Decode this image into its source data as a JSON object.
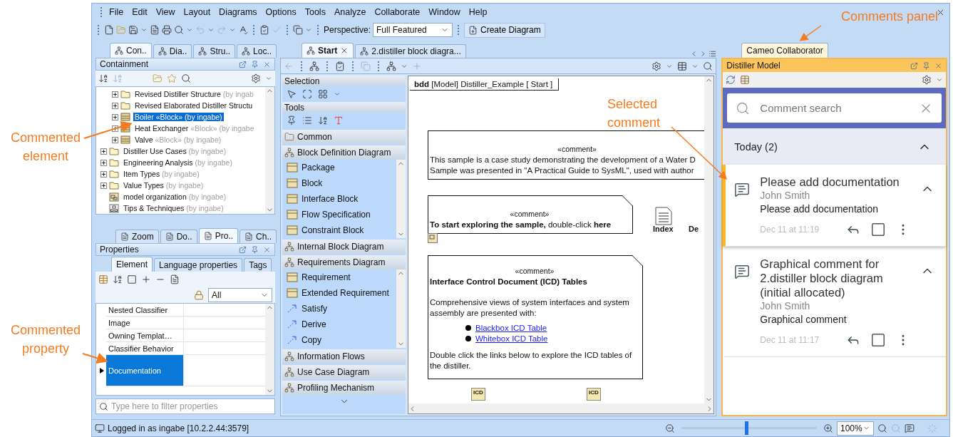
{
  "annotations": [
    {
      "text": "Commented element"
    },
    {
      "text": "Commented property"
    },
    {
      "text": "Selected comment"
    },
    {
      "text": "Comments panel"
    }
  ],
  "menu": [
    "File",
    "Edit",
    "View",
    "Layout",
    "Diagrams",
    "Options",
    "Tools",
    "Analyze",
    "Collaborate",
    "Window",
    "Help"
  ],
  "toolbar": {
    "perspective_label": "Perspective:",
    "perspective": "Full Featured",
    "create_diagram": "Create Diagram"
  },
  "browser_tabs": [
    {
      "label": "Con..",
      "selected": true
    },
    {
      "label": "Dia..",
      "selected": false
    },
    {
      "label": "Stru..",
      "selected": false
    },
    {
      "label": "Loc..",
      "selected": false
    }
  ],
  "containment": {
    "title": "Containment",
    "tree": [
      {
        "children": [
          {
            "label": "Revised Distiller Structure",
            "owner": "(by ingab",
            "kind": "folder",
            "expandable": true,
            "selected": false
          },
          {
            "label": "Revised Elaborated  Distiller Structu",
            "kind": "folder",
            "expandable": true,
            "selected": false
          },
          {
            "label": "Boiler",
            "stereotype": "«Block»",
            "owner": "(by ingabe)",
            "kind": "block",
            "expandable": true,
            "selected": true
          },
          {
            "label": "Heat Exchanger",
            "stereotype": "«Block»",
            "owner": "(by ingabe",
            "kind": "block",
            "expandable": true,
            "selected": false
          },
          {
            "label": "Valve",
            "stereotype": "«Block»",
            "owner": "(by ingabe)",
            "kind": "block",
            "expandable": true,
            "selected": false
          }
        ]
      },
      {
        "label": "Distiller Use Cases",
        "owner": "(by ingabe)",
        "kind": "folder",
        "expandable": true,
        "selected": false
      },
      {
        "label": "Engineering Analysis",
        "owner": "(by ingabe)",
        "kind": "folder",
        "expandable": true,
        "selected": false
      },
      {
        "label": "Item Types",
        "owner": "(by ingabe)",
        "kind": "folder",
        "expandable": true,
        "selected": false
      },
      {
        "label": "Value Types",
        "owner": "(by ingabe)",
        "kind": "folder",
        "expandable": true,
        "selected": false
      },
      {
        "label": "model organization",
        "owner": "(by ingabe)",
        "kind": "package-diagram",
        "expandable": false,
        "selected": false
      },
      {
        "label": "Tips & Techniques",
        "owner": "(by ingabe)",
        "kind": "diagram",
        "expandable": false,
        "selected": false
      }
    ]
  },
  "property_tabs": [
    {
      "label": "Zoom",
      "selected": false
    },
    {
      "label": "Do..",
      "selected": false
    },
    {
      "label": "Pro..",
      "selected": true
    },
    {
      "label": "Ch..",
      "selected": false
    }
  ],
  "properties": {
    "title": "Properties",
    "tabs": [
      {
        "label": "Element",
        "selected": true
      },
      {
        "label": "Language properties",
        "selected": false
      },
      {
        "label": "Tags",
        "selected": false
      }
    ],
    "filter": "All",
    "rows": [
      {
        "name": "Nested Classifier",
        "selected": false
      },
      {
        "name": "Image",
        "selected": false
      },
      {
        "name": "Owning Templat…",
        "selected": false
      },
      {
        "name": "Classifier Behavior",
        "selected": false
      },
      {
        "name": "Documentation",
        "selected": true
      }
    ],
    "search_placeholder": "Type here to filter properties"
  },
  "editor_tabs": [
    {
      "label": "Start",
      "selected": true,
      "closable": true
    },
    {
      "label": "2.distiller block diagra...",
      "selected": false,
      "closable": false
    }
  ],
  "palette": [
    {
      "title": "Selection",
      "kind": "tools"
    },
    {
      "title": "Tools",
      "kind": "tools"
    },
    {
      "title": "Common",
      "kind": "group"
    },
    {
      "title": "Block Definition Diagram",
      "kind": "group",
      "items": [
        {
          "label": "Package",
          "kind": "element"
        },
        {
          "label": "Block",
          "kind": "element"
        },
        {
          "label": "Interface Block",
          "kind": "element"
        },
        {
          "label": "Flow Specification",
          "kind": "element"
        },
        {
          "label": "Constraint Block",
          "kind": "element"
        }
      ]
    },
    {
      "title": "Internal Block Diagram",
      "kind": "group"
    },
    {
      "title": "Requirements Diagram",
      "kind": "group",
      "items": [
        {
          "label": "Requirement",
          "kind": "element"
        },
        {
          "label": "Extended Requirement",
          "kind": "element"
        },
        {
          "label": "Satisfy",
          "kind": "relation"
        },
        {
          "label": "Derive",
          "kind": "relation"
        },
        {
          "label": "Copy",
          "kind": "relation"
        }
      ]
    },
    {
      "title": "Information Flows",
      "kind": "group"
    },
    {
      "title": "Use Case Diagram",
      "kind": "group"
    },
    {
      "title": "Profiling Mechanism",
      "kind": "group"
    }
  ],
  "diagram": {
    "kind_label": "bdd",
    "title": "[Model] Distiller_Example [ Start ]",
    "index_label": "Index",
    "cut_label": "De",
    "icd_icons": [
      "ICD",
      "ICD"
    ],
    "notes": [
      {
        "stereotype": "«comment»",
        "folded": false,
        "blocks": [
          {
            "kind": "line",
            "text": "This sample is a case study demonstrating the development of a Water D"
          },
          {
            "kind": "line",
            "text": "Sample was presented in \"A Practical Guide to SysML\", used with author"
          }
        ]
      },
      {
        "stereotype": "«comment»",
        "folded": true,
        "blocks": [
          {
            "kind": "line",
            "text": "**To start exploring the sample,** double-click **here**"
          }
        ]
      },
      {
        "stereotype": "«comment»",
        "folded": true,
        "blocks": [
          {
            "kind": "heading",
            "text": "Interface Control Document (ICD) Tables"
          },
          {
            "kind": "text",
            "text": "Comprehensive views of system interfaces and system assembly are presented with:"
          },
          {
            "kind": "links",
            "items": [
              "Blackbox ICD Table",
              "Whitebox ICD Table"
            ]
          },
          {
            "kind": "text",
            "text": "Double click the links below to explore the ICD tables of the distiller."
          }
        ]
      }
    ]
  },
  "comments_panel": {
    "tab": "Cameo Collaborator",
    "title": "Distiller Model",
    "search_placeholder": "Comment search",
    "group": {
      "label": "Today (2)",
      "expanded": true
    },
    "comments": [
      {
        "title": "Please add documentation",
        "author": "John Smith",
        "body": "Please add documentation",
        "date": "Dec 11 at 11:19",
        "selected": true,
        "expanded": true,
        "resolved": false
      },
      {
        "title": "Graphical comment for 2.distiller block diagram (initial allocated)",
        "author": "John Smith",
        "body": "Graphical comment",
        "date": "Dec 11 at 11:17",
        "selected": false,
        "expanded": true,
        "resolved": false
      }
    ]
  },
  "status_bar": {
    "login": "Logged in as ingabe [10.2.2.44:3579]",
    "zoom": "100%",
    "zoom_slider": {
      "level": 0.48
    }
  }
}
